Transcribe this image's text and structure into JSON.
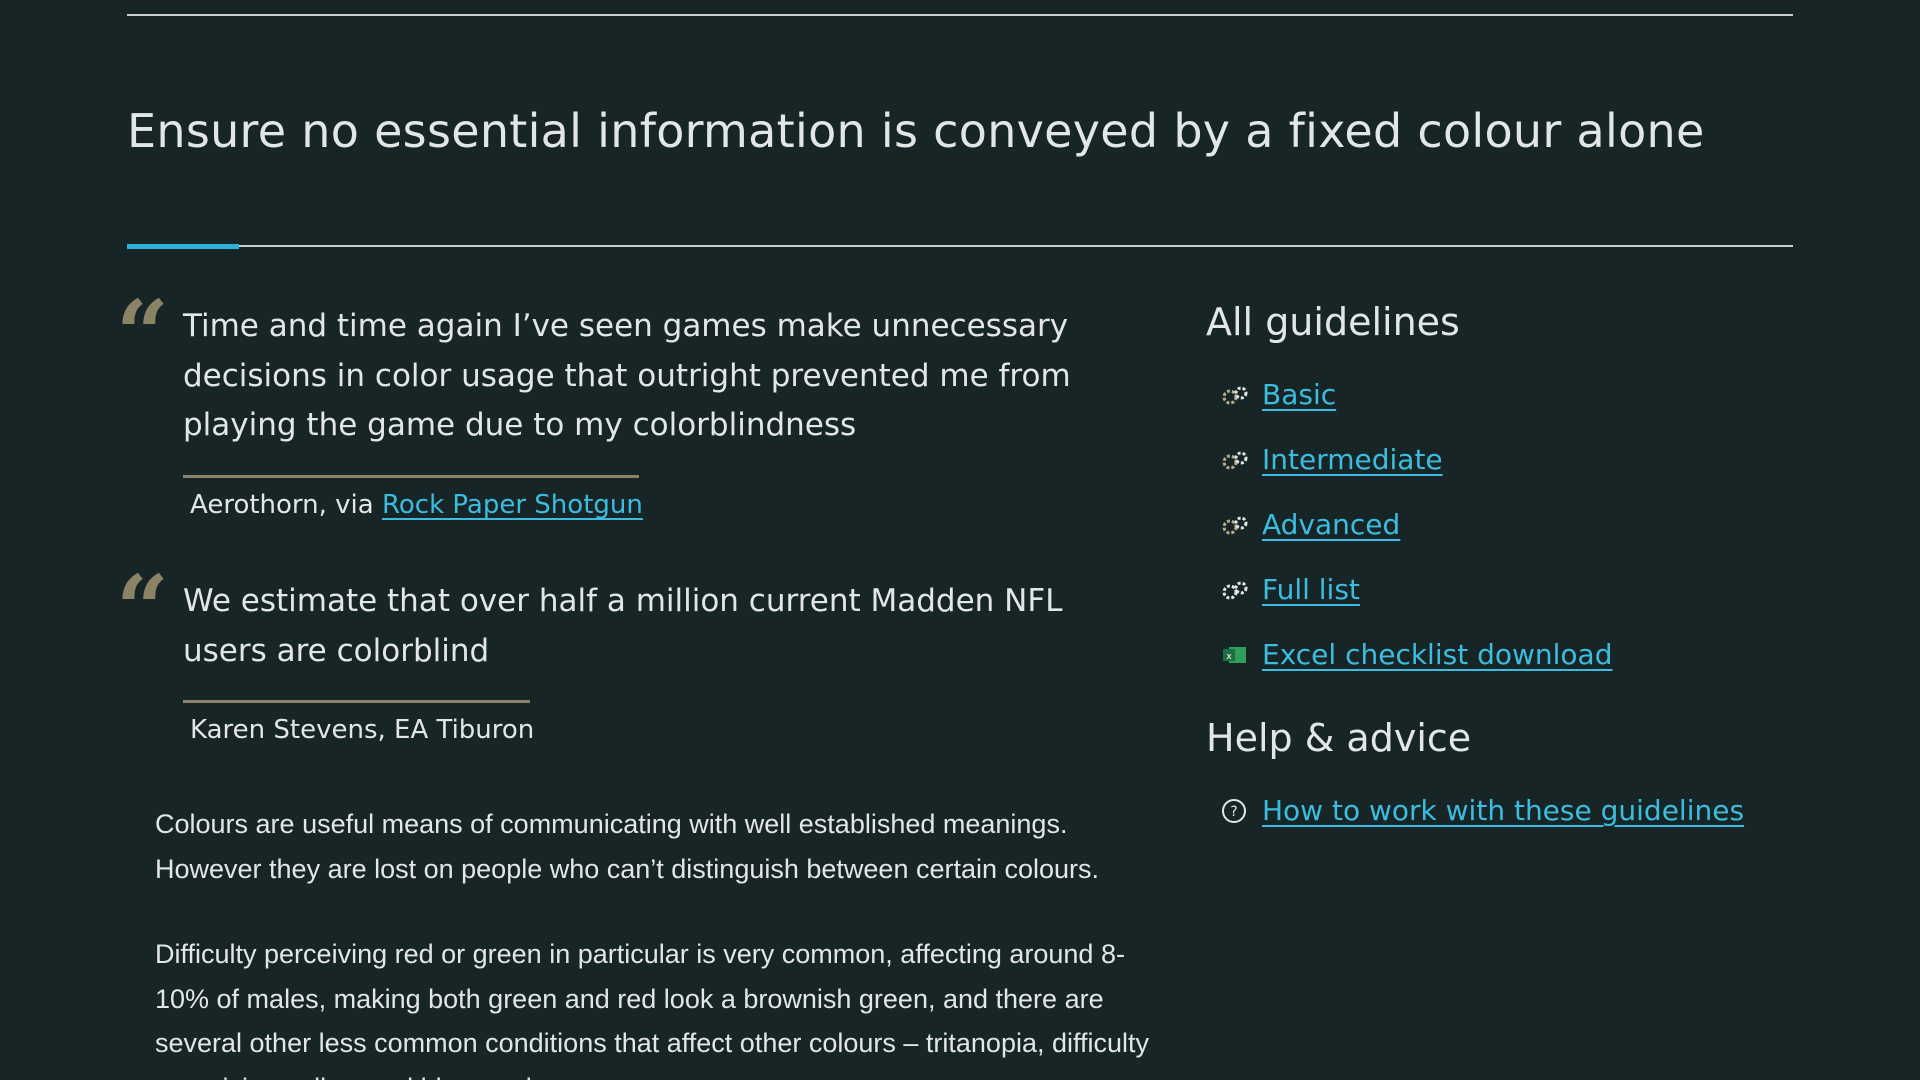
{
  "page": {
    "title": "Ensure no essential information is conveyed by a fixed colour alone"
  },
  "quotes": [
    {
      "mark": "“",
      "text": "Time and time again I’ve seen games make unnecessary decisions in color usage that outright prevented me from playing the game due to my colorblindness",
      "attribution_prefix": "Aerothorn, via ",
      "attribution_link": "Rock Paper Shotgun"
    },
    {
      "mark": "“",
      "text": "We estimate that over half a million current Madden NFL users are colorblind",
      "attribution": "Karen Stevens, EA Tiburon"
    }
  ],
  "body": {
    "para1": "Colours are useful means of communicating with well established meanings. However they are lost on people who can’t distinguish between certain colours.",
    "para2": "Difficulty perceiving red or green in particular is very common, affecting around 8-10% of males, making both green and red look a brownish green, and there are several other less common conditions that affect other colours – tritanopia, difficulty perceiving yellow and blue, and..."
  },
  "sidebar": {
    "guidelines_heading": "All guidelines",
    "guidelines": [
      {
        "label": "Basic",
        "icon": "gears-icon"
      },
      {
        "label": "Intermediate",
        "icon": "gears-icon"
      },
      {
        "label": "Advanced",
        "icon": "gears-icon"
      },
      {
        "label": "Full list",
        "icon": "gears-icon"
      },
      {
        "label": "Excel checklist download",
        "icon": "excel-icon"
      }
    ],
    "help_heading": "Help & advice",
    "help_items": [
      {
        "label": "How to work with these guidelines",
        "icon": "help-circle-icon"
      }
    ]
  },
  "colors": {
    "background": "#182526",
    "text": "#e2e6e5",
    "link": "#3cbcdf",
    "accent": "#2fb0d6",
    "quote_accent": "#8c8366"
  }
}
